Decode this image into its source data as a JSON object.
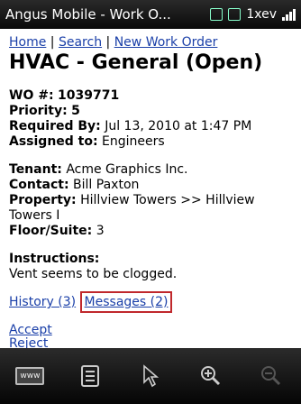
{
  "titlebar": {
    "app_title": "Angus Mobile - Work O...",
    "carrier": "1xev"
  },
  "nav": {
    "home": "Home",
    "search": "Search",
    "new_wo": "New Work Order",
    "sep": " | "
  },
  "page_title": "HVAC - General (Open)",
  "wo": {
    "wo_label": "WO #:",
    "wo_value": "1039771",
    "priority_label": "Priority:",
    "priority_value": "5",
    "required_label": "Required By:",
    "required_value": "Jul 13, 2010 at 1:47 PM",
    "assigned_label": "Assigned to:",
    "assigned_value": "Engineers"
  },
  "tenant": {
    "tenant_label": "Tenant:",
    "tenant_value": "Acme Graphics Inc.",
    "contact_label": "Contact:",
    "contact_value": "Bill Paxton",
    "property_label": "Property:",
    "property_value": "Hillview Towers >> Hillview Towers I",
    "floor_label": "Floor/Suite:",
    "floor_value": "3"
  },
  "instructions": {
    "label": "Instructions:",
    "text": "Vent seems to be clogged."
  },
  "tabs": {
    "history": "History (3)",
    "messages": "Messages (2)"
  },
  "actions": {
    "accept": "Accept",
    "reject": "Reject"
  },
  "toolbar": {
    "www_label": "www"
  }
}
